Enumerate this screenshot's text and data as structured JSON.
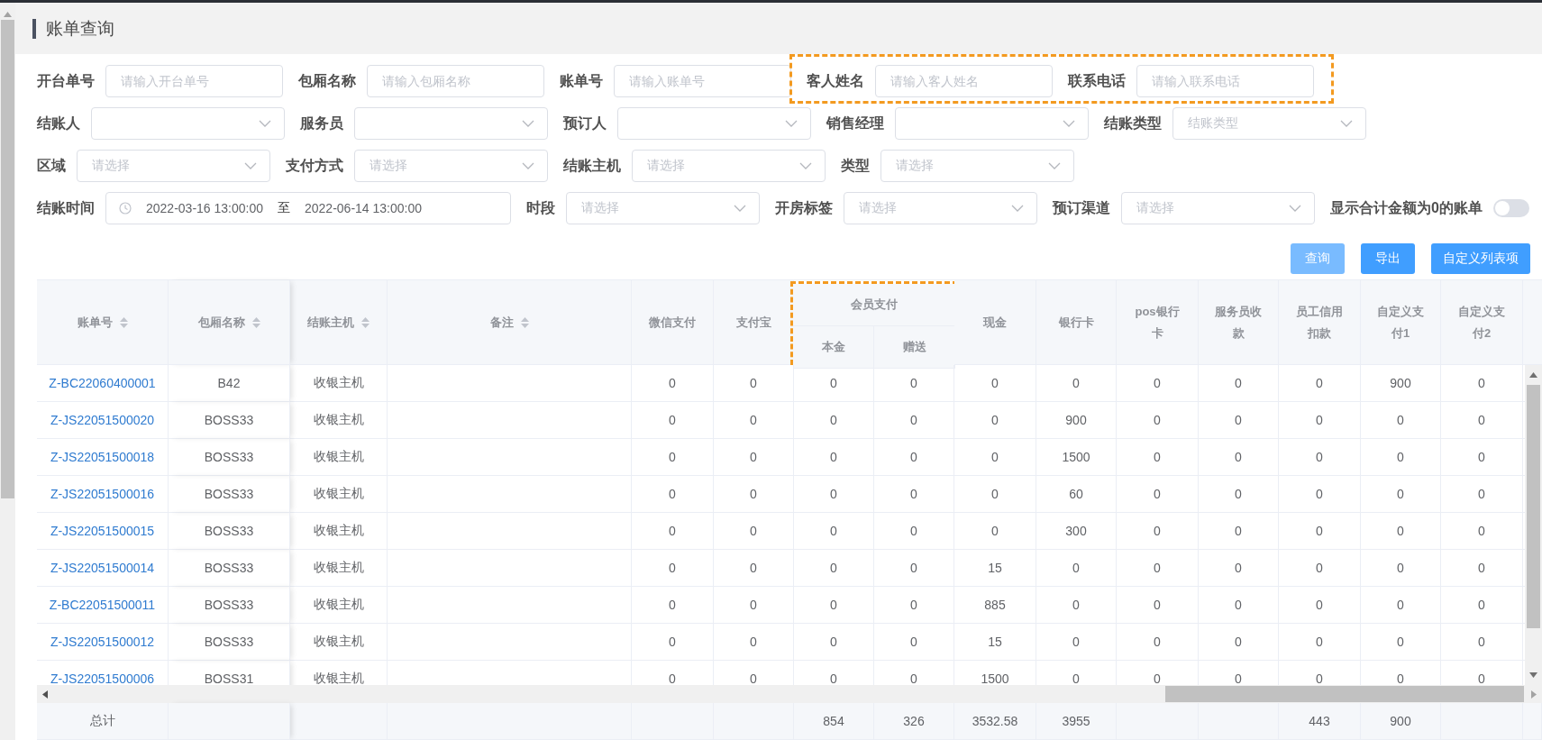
{
  "page": {
    "title": "账单查询"
  },
  "filters": [
    [
      {
        "label": "开台单号",
        "kind": "text",
        "placeholder": "请输入开台单号",
        "highlighted": false
      },
      {
        "label": "包厢名称",
        "kind": "text",
        "placeholder": "请输入包厢名称",
        "highlighted": false
      },
      {
        "label": "账单号",
        "kind": "text",
        "placeholder": "请输入账单号",
        "highlighted": false
      },
      {
        "label": "客人姓名",
        "kind": "text",
        "placeholder": "请输入客人姓名",
        "highlighted": true
      },
      {
        "label": "联系电话",
        "kind": "text",
        "placeholder": "请输入联系电话",
        "highlighted": true
      }
    ],
    [
      {
        "label": "结账人",
        "kind": "select",
        "highlighted": false
      },
      {
        "label": "服务员",
        "kind": "select",
        "highlighted": false
      },
      {
        "label": "预订人",
        "kind": "select",
        "highlighted": false
      },
      {
        "label": "销售经理",
        "kind": "select",
        "highlighted": false
      },
      {
        "label": "结账类型",
        "kind": "select",
        "placeholder": "结账类型",
        "highlighted": false
      }
    ],
    [
      {
        "label": "区域",
        "kind": "select",
        "placeholder": "请选择",
        "highlighted": false
      },
      {
        "label": "支付方式",
        "kind": "select",
        "placeholder": "请选择",
        "highlighted": false
      },
      {
        "label": "结账主机",
        "kind": "select",
        "placeholder": "请选择",
        "highlighted": false
      },
      {
        "label": "类型",
        "kind": "select",
        "placeholder": "请选择",
        "highlighted": false
      }
    ],
    [
      {
        "label": "结账时间",
        "kind": "daterange",
        "start": "2022-03-16 13:00:00",
        "separator": "至",
        "end": "2022-06-14 13:00:00",
        "highlighted": false
      },
      {
        "label": "时段",
        "kind": "select",
        "placeholder": "请选择",
        "highlighted": false
      },
      {
        "label": "开房标签",
        "kind": "select",
        "placeholder": "请选择",
        "highlighted": false
      },
      {
        "label": "预订渠道",
        "kind": "select",
        "placeholder": "请选择",
        "highlighted": false
      },
      {
        "label": "显示合计金额为0的账单",
        "kind": "switch",
        "on": false,
        "highlighted": false
      }
    ]
  ],
  "buttons": [
    {
      "label": "查询",
      "disabled": true
    },
    {
      "label": "导出",
      "disabled": false
    },
    {
      "label": "自定义列表项",
      "disabled": false
    }
  ],
  "table": {
    "columns": [
      {
        "label": "账单号",
        "kind": "link",
        "sortable": true,
        "grouped": false
      },
      {
        "label": "包厢名称",
        "kind": "text",
        "sortable": true,
        "grouped": false
      },
      {
        "label": "结账主机",
        "kind": "text",
        "sortable": true,
        "grouped": false
      },
      {
        "label": "备注",
        "kind": "text",
        "sortable": true,
        "grouped": false
      },
      {
        "label": "微信支付",
        "kind": "text",
        "sortable": false,
        "grouped": false
      },
      {
        "label": "支付宝",
        "kind": "text",
        "sortable": false,
        "grouped": false
      },
      {
        "label": "本金",
        "kind": "text",
        "sortable": false,
        "grouped": true
      },
      {
        "label": "赠送",
        "kind": "text",
        "sortable": false,
        "grouped": true
      },
      {
        "label": "现金",
        "kind": "text",
        "sortable": false,
        "grouped": false
      },
      {
        "label": "银行卡",
        "kind": "text",
        "sortable": false,
        "grouped": false
      },
      {
        "label": "pos银行卡",
        "kind": "text",
        "sortable": false,
        "grouped": false
      },
      {
        "label": "服务员收款",
        "kind": "text",
        "sortable": false,
        "grouped": false
      },
      {
        "label": "员工信用扣款",
        "kind": "text",
        "sortable": false,
        "grouped": false
      },
      {
        "label": "自定义支付1",
        "kind": "text",
        "sortable": false,
        "grouped": false
      },
      {
        "label": "自定义支付2",
        "kind": "text",
        "sortable": false,
        "grouped": false
      }
    ],
    "rows": [
      [
        "Z-BC22060400001",
        "B42",
        "收银主机",
        "",
        "0",
        "0",
        "0",
        "0",
        "0",
        "0",
        "0",
        "0",
        "0",
        "900",
        "0"
      ],
      [
        "Z-JS22051500020",
        "BOSS33",
        "收银主机",
        "",
        "0",
        "0",
        "0",
        "0",
        "0",
        "900",
        "0",
        "0",
        "0",
        "0",
        "0"
      ],
      [
        "Z-JS22051500018",
        "BOSS33",
        "收银主机",
        "",
        "0",
        "0",
        "0",
        "0",
        "0",
        "1500",
        "0",
        "0",
        "0",
        "0",
        "0"
      ],
      [
        "Z-JS22051500016",
        "BOSS33",
        "收银主机",
        "",
        "0",
        "0",
        "0",
        "0",
        "0",
        "60",
        "0",
        "0",
        "0",
        "0",
        "0"
      ],
      [
        "Z-JS22051500015",
        "BOSS33",
        "收银主机",
        "",
        "0",
        "0",
        "0",
        "0",
        "0",
        "300",
        "0",
        "0",
        "0",
        "0",
        "0"
      ],
      [
        "Z-JS22051500014",
        "BOSS33",
        "收银主机",
        "",
        "0",
        "0",
        "0",
        "0",
        "15",
        "0",
        "0",
        "0",
        "0",
        "0",
        "0"
      ],
      [
        "Z-BC22051500011",
        "BOSS33",
        "收银主机",
        "",
        "0",
        "0",
        "0",
        "0",
        "885",
        "0",
        "0",
        "0",
        "0",
        "0",
        "0"
      ],
      [
        "Z-JS22051500012",
        "BOSS33",
        "收银主机",
        "",
        "0",
        "0",
        "0",
        "0",
        "15",
        "0",
        "0",
        "0",
        "0",
        "0",
        "0"
      ],
      [
        "Z-JS22051500006",
        "BOSS31",
        "收银主机",
        "",
        "0",
        "0",
        "0",
        "0",
        "1500",
        "0",
        "0",
        "0",
        "0",
        "0",
        "0"
      ]
    ],
    "header_groups": [
      {
        "label": "会员支付",
        "highlighted": true
      }
    ],
    "totals": {
      "column_1": "总计",
      "column_7": "854",
      "column_8": "326",
      "column_9": "3532.58",
      "column_10": "3955",
      "column_13": "443",
      "column_14": "900"
    }
  }
}
